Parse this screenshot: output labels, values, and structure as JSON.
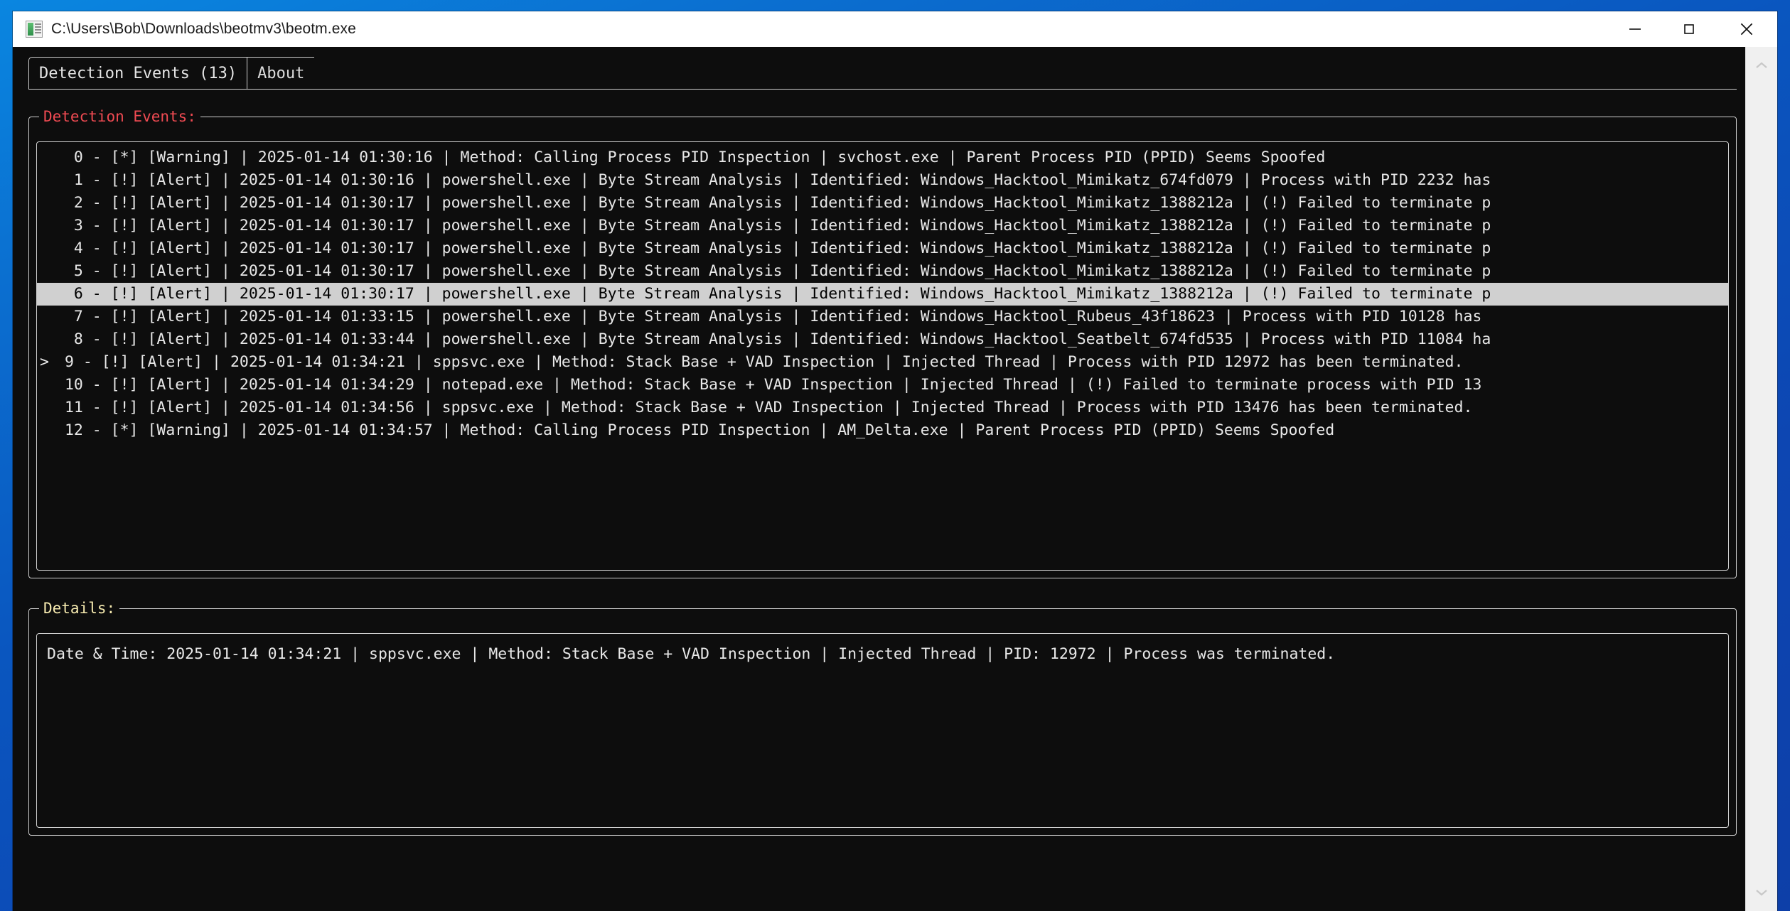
{
  "window": {
    "title": "C:\\Users\\Bob\\Downloads\\beotmv3\\beotm.exe",
    "icon": "app-icon",
    "controls": {
      "minimize": "minimize-button",
      "maximize": "maximize-button",
      "close": "close-button"
    }
  },
  "tabs": [
    {
      "label": "Detection Events (13)",
      "active": true
    },
    {
      "label": "About",
      "active": false
    }
  ],
  "events_group": {
    "legend": "Detection Events:",
    "legend_color": "#ef4a52",
    "rows": [
      {
        "marker": "",
        "text": "  0 - [*] [Warning] | 2025-01-14 01:30:16 | Method: Calling Process PID Inspection | svchost.exe | Parent Process PID (PPID) Seems Spoofed",
        "selected": false
      },
      {
        "marker": "",
        "text": "  1 - [!] [Alert] | 2025-01-14 01:30:16 | powershell.exe | Byte Stream Analysis | Identified: Windows_Hacktool_Mimikatz_674fd079 | Process with PID 2232 has",
        "selected": false
      },
      {
        "marker": "",
        "text": "  2 - [!] [Alert] | 2025-01-14 01:30:17 | powershell.exe | Byte Stream Analysis | Identified: Windows_Hacktool_Mimikatz_1388212a | (!) Failed to terminate p",
        "selected": false
      },
      {
        "marker": "",
        "text": "  3 - [!] [Alert] | 2025-01-14 01:30:17 | powershell.exe | Byte Stream Analysis | Identified: Windows_Hacktool_Mimikatz_1388212a | (!) Failed to terminate p",
        "selected": false
      },
      {
        "marker": "",
        "text": "  4 - [!] [Alert] | 2025-01-14 01:30:17 | powershell.exe | Byte Stream Analysis | Identified: Windows_Hacktool_Mimikatz_1388212a | (!) Failed to terminate p",
        "selected": false
      },
      {
        "marker": "",
        "text": "  5 - [!] [Alert] | 2025-01-14 01:30:17 | powershell.exe | Byte Stream Analysis | Identified: Windows_Hacktool_Mimikatz_1388212a | (!) Failed to terminate p",
        "selected": false
      },
      {
        "marker": "",
        "text": "  6 - [!] [Alert] | 2025-01-14 01:30:17 | powershell.exe | Byte Stream Analysis | Identified: Windows_Hacktool_Mimikatz_1388212a | (!) Failed to terminate p",
        "selected": true
      },
      {
        "marker": "",
        "text": "  7 - [!] [Alert] | 2025-01-14 01:33:15 | powershell.exe | Byte Stream Analysis | Identified: Windows_Hacktool_Rubeus_43f18623 | Process with PID 10128 has",
        "selected": false
      },
      {
        "marker": "",
        "text": "  8 - [!] [Alert] | 2025-01-14 01:33:44 | powershell.exe | Byte Stream Analysis | Identified: Windows_Hacktool_Seatbelt_674fd535 | Process with PID 11084 ha",
        "selected": false
      },
      {
        "marker": ">",
        "text": " 9 - [!] [Alert] | 2025-01-14 01:34:21 | sppsvc.exe | Method: Stack Base + VAD Inspection | Injected Thread | Process with PID 12972 has been terminated.",
        "selected": false
      },
      {
        "marker": "",
        "text": " 10 - [!] [Alert] | 2025-01-14 01:34:29 | notepad.exe | Method: Stack Base + VAD Inspection | Injected Thread | (!) Failed to terminate process with PID 13",
        "selected": false
      },
      {
        "marker": "",
        "text": " 11 - [!] [Alert] | 2025-01-14 01:34:56 | sppsvc.exe | Method: Stack Base + VAD Inspection | Injected Thread | Process with PID 13476 has been terminated.",
        "selected": false
      },
      {
        "marker": "",
        "text": " 12 - [*] [Warning] | 2025-01-14 01:34:57 | Method: Calling Process PID Inspection | AM_Delta.exe | Parent Process PID (PPID) Seems Spoofed",
        "selected": false
      }
    ]
  },
  "details_group": {
    "legend": "Details:",
    "legend_color": "#f7ebb0",
    "text": "Date & Time: 2025-01-14 01:34:21 | sppsvc.exe | Method: Stack Base + VAD Inspection | Injected Thread | PID: 12972 | Process was terminated."
  },
  "scrollbar": {
    "up_arrow": "chevron-up-icon",
    "down_arrow": "chevron-down-icon"
  }
}
